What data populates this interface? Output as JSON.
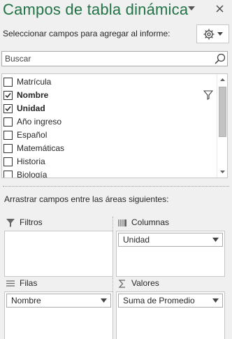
{
  "pane": {
    "title": "Campos de tabla dinámica",
    "choose_label": "Seleccionar campos para agregar al informe:",
    "tools_icon": "gear-icon",
    "dropdown_icon": "chevron-down-icon",
    "close_icon": "close-icon",
    "accent_color": "#217346"
  },
  "search": {
    "placeholder": "Buscar",
    "value": ""
  },
  "fields": [
    {
      "label": "Matrícula",
      "checked": false,
      "bold": false,
      "filtered": false
    },
    {
      "label": "Nombre",
      "checked": true,
      "bold": true,
      "filtered": true
    },
    {
      "label": "Unidad",
      "checked": true,
      "bold": true,
      "filtered": false
    },
    {
      "label": "Año ingreso",
      "checked": false,
      "bold": false,
      "filtered": false
    },
    {
      "label": "Español",
      "checked": false,
      "bold": false,
      "filtered": false
    },
    {
      "label": "Matemáticas",
      "checked": false,
      "bold": false,
      "filtered": false
    },
    {
      "label": "Historia",
      "checked": false,
      "bold": false,
      "filtered": false
    },
    {
      "label": "Biología",
      "checked": false,
      "bold": false,
      "filtered": false
    }
  ],
  "areas_label": "Arrastrar campos entre las áreas siguientes:",
  "areas": {
    "filters": {
      "title": "Filtros",
      "icon": "filter-icon",
      "items": []
    },
    "columns": {
      "title": "Columnas",
      "icon": "columns-icon",
      "items": [
        "Unidad"
      ]
    },
    "rows": {
      "title": "Filas",
      "icon": "rows-icon",
      "items": [
        "Nombre"
      ]
    },
    "values": {
      "title": "Valores",
      "icon": "sigma-icon",
      "items": [
        "Suma de Promedio"
      ]
    }
  }
}
